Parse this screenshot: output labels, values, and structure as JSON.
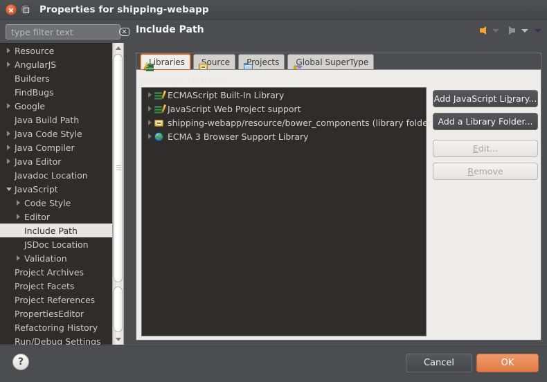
{
  "window": {
    "title": "Properties for shipping-webapp",
    "close_icon": "close-icon",
    "maximize_icon": "maximize-icon"
  },
  "filter": {
    "placeholder": "type filter text",
    "value": "",
    "clear_icon": "clear-icon"
  },
  "sidebar": {
    "items": [
      {
        "label": "Resource",
        "expandable": true,
        "expanded": false,
        "indent": 0,
        "selected": false
      },
      {
        "label": "AngularJS",
        "expandable": true,
        "expanded": false,
        "indent": 0,
        "selected": false
      },
      {
        "label": "Builders",
        "expandable": false,
        "expanded": false,
        "indent": 0,
        "selected": false
      },
      {
        "label": "FindBugs",
        "expandable": false,
        "expanded": false,
        "indent": 0,
        "selected": false
      },
      {
        "label": "Google",
        "expandable": true,
        "expanded": false,
        "indent": 0,
        "selected": false
      },
      {
        "label": "Java Build Path",
        "expandable": false,
        "expanded": false,
        "indent": 0,
        "selected": false
      },
      {
        "label": "Java Code Style",
        "expandable": true,
        "expanded": false,
        "indent": 0,
        "selected": false
      },
      {
        "label": "Java Compiler",
        "expandable": true,
        "expanded": false,
        "indent": 0,
        "selected": false
      },
      {
        "label": "Java Editor",
        "expandable": true,
        "expanded": false,
        "indent": 0,
        "selected": false
      },
      {
        "label": "Javadoc Location",
        "expandable": false,
        "expanded": false,
        "indent": 0,
        "selected": false
      },
      {
        "label": "JavaScript",
        "expandable": true,
        "expanded": true,
        "indent": 0,
        "selected": false
      },
      {
        "label": "Code Style",
        "expandable": true,
        "expanded": false,
        "indent": 1,
        "selected": false
      },
      {
        "label": "Editor",
        "expandable": true,
        "expanded": false,
        "indent": 1,
        "selected": false
      },
      {
        "label": "Include Path",
        "expandable": false,
        "expanded": false,
        "indent": 1,
        "selected": true
      },
      {
        "label": "JSDoc Location",
        "expandable": false,
        "expanded": false,
        "indent": 1,
        "selected": false
      },
      {
        "label": "Validation",
        "expandable": true,
        "expanded": false,
        "indent": 1,
        "selected": false
      },
      {
        "label": "Project Archives",
        "expandable": false,
        "expanded": false,
        "indent": 0,
        "selected": false
      },
      {
        "label": "Project Facets",
        "expandable": false,
        "expanded": false,
        "indent": 0,
        "selected": false
      },
      {
        "label": "Project References",
        "expandable": false,
        "expanded": false,
        "indent": 0,
        "selected": false
      },
      {
        "label": "PropertiesEditor",
        "expandable": false,
        "expanded": false,
        "indent": 0,
        "selected": false
      },
      {
        "label": "Refactoring History",
        "expandable": false,
        "expanded": false,
        "indent": 0,
        "selected": false
      },
      {
        "label": "Run/Debug Settings",
        "expandable": false,
        "expanded": false,
        "indent": 0,
        "selected": false
      }
    ]
  },
  "page": {
    "title": "Include Path"
  },
  "nav": {
    "back_icon": "back-arrow-icon",
    "back_menu_icon": "chevron-down-icon",
    "forward_icon": "forward-arrow-icon",
    "forward_menu_icon": "chevron-down-icon",
    "view_menu_icon": "chevron-down-icon"
  },
  "tabs": [
    {
      "label": "Libraries",
      "mnemonic": "L",
      "icon": "libraries-icon",
      "active": true
    },
    {
      "label": "Source",
      "mnemonic": "S",
      "icon": "source-icon",
      "active": false
    },
    {
      "label": "Projects",
      "mnemonic": "P",
      "icon": "projects-icon",
      "active": false
    },
    {
      "label": "Global SuperType",
      "mnemonic": "G",
      "icon": "supertype-icon",
      "active": false
    }
  ],
  "libraries": {
    "label": "JavaScript Libraries:",
    "items": [
      {
        "name": "ECMAScript Built-In Library",
        "icon": "library-books-icon"
      },
      {
        "name": "JavaScript Web Project support",
        "icon": "library-books-icon"
      },
      {
        "name": "shipping-webapp/resource/bower_components (library folder)",
        "icon": "library-folder-icon"
      },
      {
        "name": "ECMA 3 Browser Support Library",
        "icon": "globe-icon"
      }
    ]
  },
  "side_buttons": [
    {
      "label_pre": "Add JavaScript Li",
      "mnemonic": "b",
      "label_post": "rary...",
      "enabled": true
    },
    {
      "label_pre": "Add a Library Folder...",
      "mnemonic": "",
      "label_post": "",
      "enabled": true
    },
    {
      "label_pre": "",
      "mnemonic": "E",
      "label_post": "dit...",
      "enabled": false
    },
    {
      "label_pre": "",
      "mnemonic": "R",
      "label_post": "emove",
      "enabled": false
    }
  ],
  "footer": {
    "help_icon": "help-icon",
    "help_label": "?",
    "cancel_label": "Cancel",
    "ok_label": "OK"
  },
  "colors": {
    "accent_orange": "#e07a45",
    "nav_back": "#f0a830",
    "dialog_bg": "#4b4d50",
    "list_bg": "#2f2d2c",
    "tab_active_bg": "#efeeea",
    "selection_bg": "#e8e6e2"
  }
}
